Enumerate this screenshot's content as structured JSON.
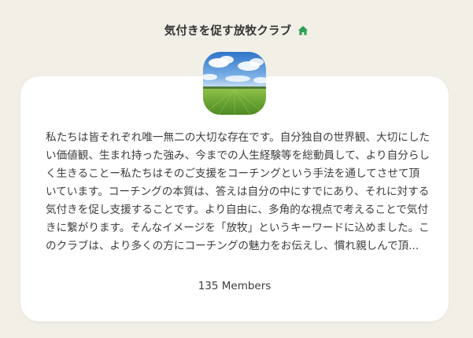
{
  "club": {
    "title": "気付きを促す放牧クラブ",
    "home_icon": "home-icon",
    "home_icon_color": "#2f9e55",
    "avatar": "landscape-photo",
    "description": "私たちは皆それぞれ唯一無二の大切な存在です。自分独自の世界観、大切にしたい価値観、生まれ持った強み、今までの人生経験等を総動員して、より自分らしく生きることー私たちはそのご支援をコーチングという手法を通してさせて頂いています。コーチングの本質は、答えは自分の中にすでにあり、それに対する気付きを促し支援することです。より自由に、多角的な視点で考えることで気付きに繋がります。そんなイメージを「放牧」というキーワードに込めました。このクラブは、より多くの方にコーチングの魅力をお伝えし、慣れ親しんで頂...",
    "members": "135 Members"
  },
  "colors": {
    "background": "#f1efe6",
    "card": "#ffffff",
    "text": "#3d3d3d"
  }
}
